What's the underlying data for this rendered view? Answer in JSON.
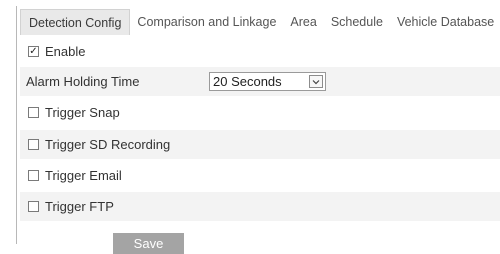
{
  "tabs": [
    {
      "label": "Detection Config",
      "active": true
    },
    {
      "label": "Comparison and Linkage",
      "active": false
    },
    {
      "label": "Area",
      "active": false
    },
    {
      "label": "Schedule",
      "active": false
    },
    {
      "label": "Vehicle Database",
      "active": false
    }
  ],
  "enable": {
    "label": "Enable",
    "checked": true,
    "mark": "☑"
  },
  "alarm_holding_time": {
    "label": "Alarm Holding Time",
    "value": "20 Seconds",
    "arrow": "⌄"
  },
  "triggers": [
    {
      "label": "Trigger Snap",
      "checked": false
    },
    {
      "label": "Trigger SD Recording",
      "checked": false
    },
    {
      "label": "Trigger Email",
      "checked": false
    },
    {
      "label": "Trigger FTP",
      "checked": false
    }
  ],
  "save_label": "Save",
  "colors": {
    "shaded_row": "#f3f3f3",
    "save_button": "#a4a4a4",
    "active_tab": "#e9e9e9"
  }
}
